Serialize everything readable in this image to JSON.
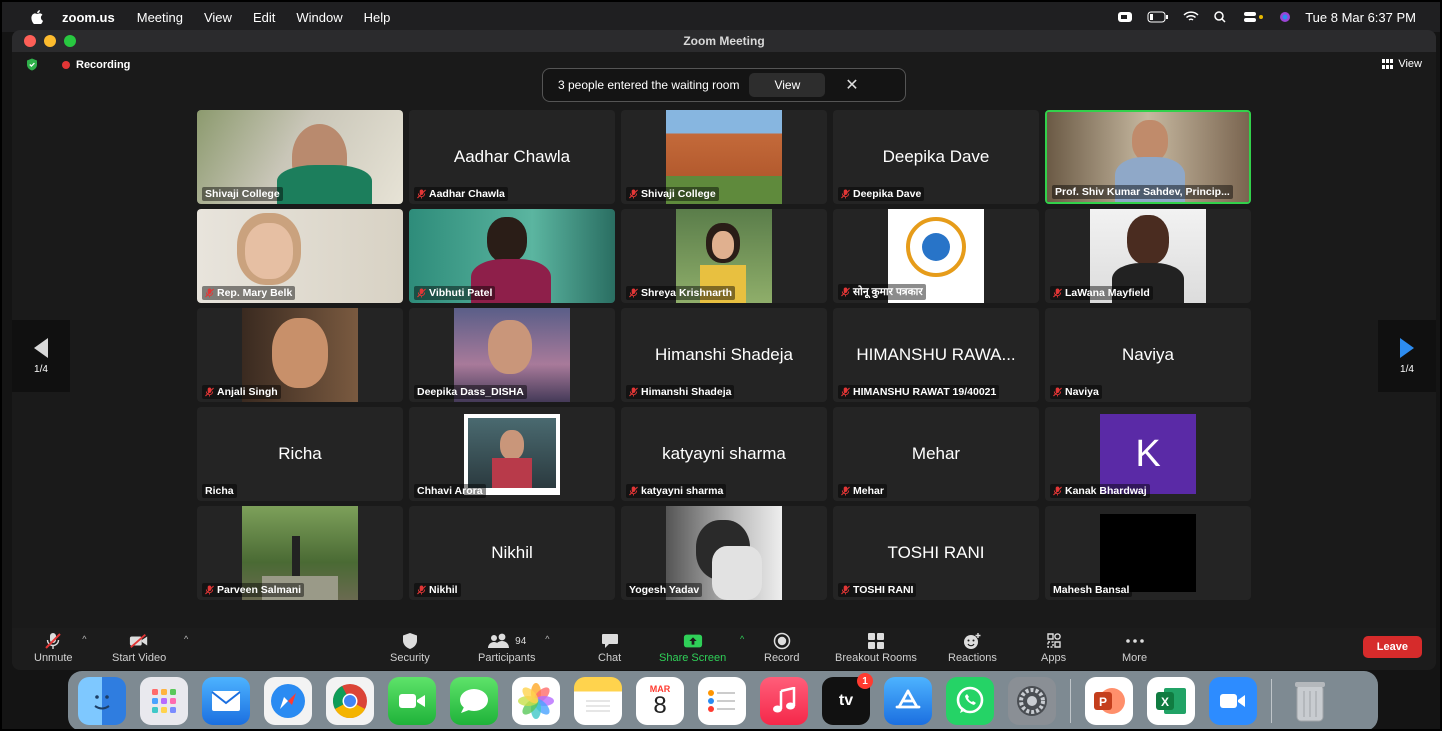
{
  "menubar": {
    "app_name": "zoom.us",
    "menus": [
      "Meeting",
      "View",
      "Edit",
      "Window",
      "Help"
    ],
    "clock": "Tue 8 Mar  6:37 PM"
  },
  "window": {
    "title": "Zoom Meeting",
    "recording_label": "Recording",
    "view_label": "View"
  },
  "notification": {
    "text": "3 people entered the waiting room",
    "button_label": "View",
    "close_glyph": "✕"
  },
  "pager": {
    "left_label": "1/4",
    "right_label": "1/4"
  },
  "participants": [
    {
      "label": "Shivaji College",
      "big": "",
      "muted": false,
      "video": "photo-woman-green"
    },
    {
      "label": "Aadhar Chawla",
      "big": "Aadhar Chawla",
      "muted": true,
      "video": ""
    },
    {
      "label": "Shivaji College",
      "big": "",
      "muted": true,
      "video": "photo-building"
    },
    {
      "label": "Deepika Dave",
      "big": "Deepika Dave",
      "muted": true,
      "video": ""
    },
    {
      "label": "Prof. Shiv Kumar Sahdev, Princip...",
      "big": "",
      "muted": false,
      "video": "photo-man-office",
      "active": true
    },
    {
      "label": "Rep. Mary Belk",
      "big": "",
      "muted": true,
      "video": "photo-woman-blonde"
    },
    {
      "label": "Vibhuti Patel",
      "big": "",
      "muted": true,
      "video": "photo-woman-teal"
    },
    {
      "label": "Shreya Krishnarth",
      "big": "",
      "muted": true,
      "video": "photo-girl-small"
    },
    {
      "label": "सोनू कुमार पत्रकार",
      "big": "",
      "muted": true,
      "video": "photo-logo"
    },
    {
      "label": "LaWana Mayfield",
      "big": "",
      "muted": true,
      "video": "photo-woman-smile"
    },
    {
      "label": "Anjali Singh",
      "big": "",
      "muted": true,
      "video": "photo-girl-face"
    },
    {
      "label": "Deepika Dass_DISHA",
      "big": "",
      "muted": false,
      "video": "photo-girl-market"
    },
    {
      "label": "Himanshi Shadeja",
      "big": "Himanshi Shadeja",
      "muted": true,
      "video": ""
    },
    {
      "label": "HIMANSHU RAWAT 19/40021",
      "big": "HIMANSHU RAWA...",
      "muted": true,
      "video": ""
    },
    {
      "label": "Naviya",
      "big": "Naviya",
      "muted": true,
      "video": ""
    },
    {
      "label": "Richa",
      "big": "Richa",
      "muted": false,
      "video": ""
    },
    {
      "label": "Chhavi Arora",
      "big": "",
      "muted": false,
      "video": "photo-girl-frame"
    },
    {
      "label": "katyayni sharma",
      "big": "katyayni sharma",
      "muted": true,
      "video": ""
    },
    {
      "label": "Mehar",
      "big": "Mehar",
      "muted": true,
      "video": ""
    },
    {
      "label": "Kanak Bhardwaj",
      "big": "",
      "muted": true,
      "video": "avatar-k",
      "avatar_letter": "K"
    },
    {
      "label": "Parveen Salmani",
      "big": "",
      "muted": true,
      "video": "photo-tree"
    },
    {
      "label": "Nikhil",
      "big": "Nikhil",
      "muted": true,
      "video": ""
    },
    {
      "label": "Yogesh Yadav",
      "big": "",
      "muted": false,
      "video": "photo-bw"
    },
    {
      "label": "TOSHI RANI",
      "big": "TOSHI RANI",
      "muted": true,
      "video": ""
    },
    {
      "label": "Mahesh Bansal",
      "big": "",
      "muted": false,
      "video": "black"
    }
  ],
  "toolbar": {
    "unmute": "Unmute",
    "start_video": "Start Video",
    "security": "Security",
    "participants": "Participants",
    "participants_count": "94",
    "chat": "Chat",
    "share_screen": "Share Screen",
    "record": "Record",
    "breakout": "Breakout Rooms",
    "reactions": "Reactions",
    "apps": "Apps",
    "more": "More",
    "leave": "Leave"
  },
  "dock": {
    "calendar_month": "MAR",
    "calendar_day": "8",
    "tv_badge": "1",
    "tv_label": "tv"
  },
  "colors": {
    "accent_green": "#2fd058",
    "leave_red": "#d62b2b",
    "active_speaker": "#32d14b"
  }
}
